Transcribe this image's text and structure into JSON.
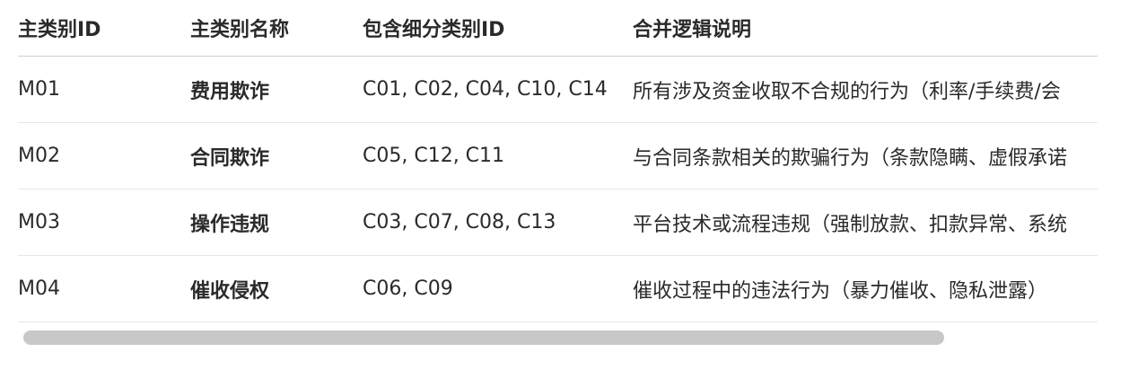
{
  "table": {
    "headers": [
      "主类别ID",
      "主类别名称",
      "包含细分类别ID",
      "合并逻辑说明"
    ],
    "rows": [
      [
        "M01",
        "费用欺诈",
        "C01, C02, C04, C10, C14",
        "所有涉及资金收取不合规的行为（利率/手续费/会"
      ],
      [
        "M02",
        "合同欺诈",
        "C05, C12, C11",
        "与合同条款相关的欺骗行为（条款隐瞒、虚假承诺"
      ],
      [
        "M03",
        "操作违规",
        "C03, C07, C08, C13",
        "平台技术或流程违规（强制放款、扣款异常、系统"
      ],
      [
        "M04",
        "催收侵权",
        "C06, C09",
        "催收过程中的违法行为（暴力催收、隐私泄露）"
      ]
    ]
  },
  "scrollbar": {
    "horizontal_position": 0.0
  }
}
